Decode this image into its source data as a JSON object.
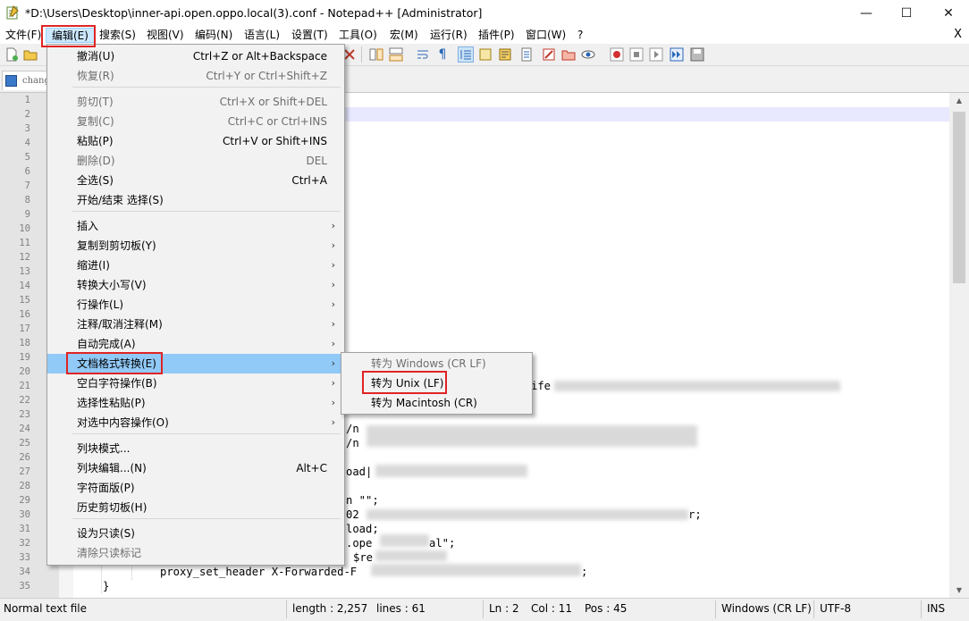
{
  "window": {
    "title": "*D:\\Users\\Desktop\\inner-api.open.oppo.local(3).conf - Notepad++ [Administrator]",
    "minimize": "—",
    "maximize": "☐",
    "close": "✕"
  },
  "menubar": {
    "items": [
      "文件(F)",
      "编辑(E)",
      "搜索(S)",
      "视图(V)",
      "编码(N)",
      "语言(L)",
      "设置(T)",
      "工具(O)",
      "宏(M)",
      "运行(R)",
      "插件(P)",
      "窗口(W)",
      "?"
    ],
    "close": "X"
  },
  "tab": {
    "label": "change"
  },
  "gutter": {
    "line_numbers": [
      "1",
      "2",
      "3",
      "4",
      "5",
      "6",
      "7",
      "8",
      "9",
      "10",
      "11",
      "12",
      "13",
      "14",
      "15",
      "16",
      "17",
      "18",
      "19",
      "20",
      "21",
      "22",
      "23",
      "24",
      "25",
      "26",
      "27",
      "28",
      "29",
      "30",
      "31",
      "32",
      "33",
      "34",
      "35"
    ]
  },
  "code_fragments": {
    "l21": "ife",
    "l24": "/n",
    "l25": "/n",
    "l27": "oad|",
    "l29": "n \"\";",
    "l30": "02",
    "l30b": "r;",
    "l31": "load;",
    "l32": ".ope",
    "l32b": "al\";",
    "l33": "$re",
    "l34": "proxy_set_header X-Forwarded-F",
    "l34b": ";",
    "l35": "}"
  },
  "edit_menu": {
    "items": [
      {
        "label": "撤消(U)",
        "shortcut": "Ctrl+Z or Alt+Backspace",
        "disabled": false
      },
      {
        "label": "恢复(R)",
        "shortcut": "Ctrl+Y or Ctrl+Shift+Z",
        "disabled": true
      },
      {
        "label": "剪切(T)",
        "shortcut": "Ctrl+X or Shift+DEL",
        "disabled": true
      },
      {
        "label": "复制(C)",
        "shortcut": "Ctrl+C or Ctrl+INS",
        "disabled": true
      },
      {
        "label": "粘贴(P)",
        "shortcut": "Ctrl+V or Shift+INS",
        "disabled": false
      },
      {
        "label": "删除(D)",
        "shortcut": "DEL",
        "disabled": true
      },
      {
        "label": "全选(S)",
        "shortcut": "Ctrl+A",
        "disabled": false
      },
      {
        "label": "开始/结束 选择(S)",
        "shortcut": "",
        "disabled": false
      },
      {
        "label": "插入",
        "submenu": true
      },
      {
        "label": "复制到剪切板(Y)",
        "submenu": true
      },
      {
        "label": "缩进(I)",
        "submenu": true
      },
      {
        "label": "转换大小写(V)",
        "submenu": true
      },
      {
        "label": "行操作(L)",
        "submenu": true
      },
      {
        "label": "注释/取消注释(M)",
        "submenu": true
      },
      {
        "label": "自动完成(A)",
        "submenu": true
      },
      {
        "label": "文档格式转换(E)",
        "submenu": true,
        "highlighted": true
      },
      {
        "label": "空白字符操作(B)",
        "submenu": true
      },
      {
        "label": "选择性粘贴(P)",
        "submenu": true
      },
      {
        "label": "对选中内容操作(O)",
        "submenu": true
      },
      {
        "label": "列块模式...",
        "shortcut": ""
      },
      {
        "label": "列块编辑...(N)",
        "shortcut": "Alt+C"
      },
      {
        "label": "字符面版(P)",
        "shortcut": ""
      },
      {
        "label": "历史剪切板(H)",
        "shortcut": ""
      },
      {
        "label": "设为只读(S)",
        "shortcut": ""
      },
      {
        "label": "清除只读标记",
        "shortcut": "",
        "disabled": true
      }
    ]
  },
  "eol_submenu": {
    "items": [
      {
        "label": "转为 Windows (CR LF)",
        "disabled": true
      },
      {
        "label": "转为 Unix (LF)",
        "disabled": false
      },
      {
        "label": "转为 Macintosh (CR)",
        "disabled": false
      }
    ]
  },
  "statusbar": {
    "type": "Normal text file",
    "length": "length : 2,257",
    "lines": "lines : 61",
    "ln": "Ln : 2",
    "col": "Col : 11",
    "pos": "Pos : 45",
    "eol": "Windows (CR LF)",
    "encoding": "UTF-8",
    "mode": "INS"
  },
  "colors": {
    "highlight": "#91c9f7",
    "annotation": "#e02424",
    "current_line": "#e8e8ff"
  }
}
